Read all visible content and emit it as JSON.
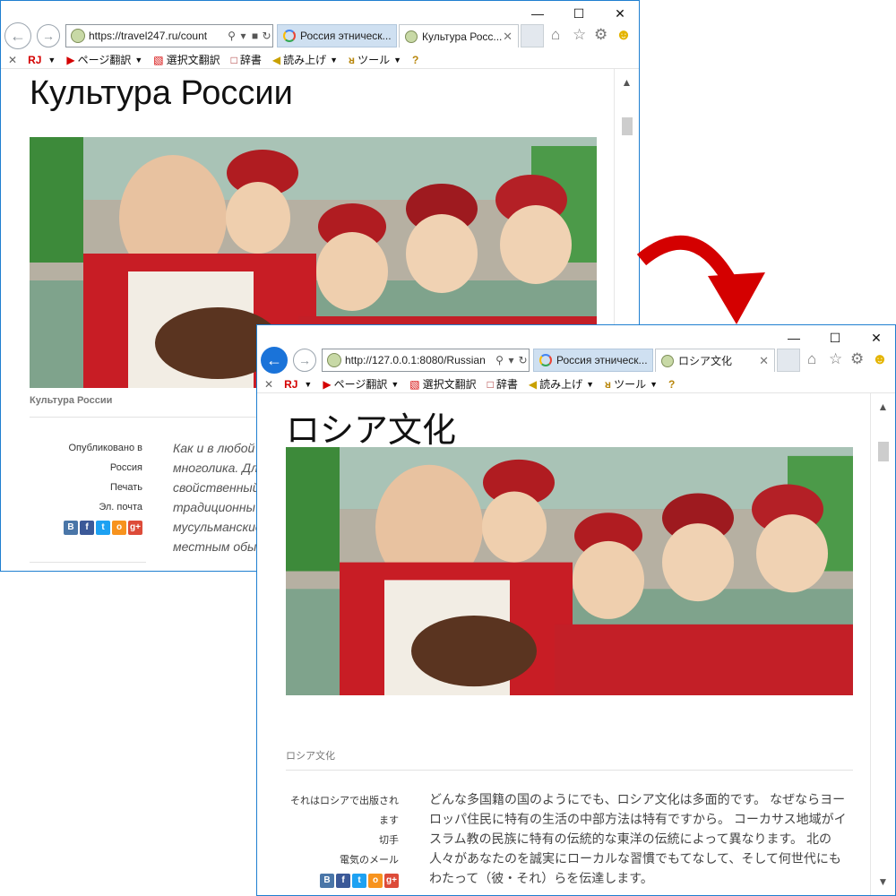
{
  "colors": {
    "accent": "#1a73d9",
    "window_border": "#1f7fd0",
    "arrow": "#d40000"
  },
  "window1": {
    "address_url": "https://travel247.ru/count",
    "tabs": [
      {
        "label": "Россия этническ...",
        "icon": "google-icon",
        "active": false
      },
      {
        "label": "Культура Росс...",
        "icon": "site-favicon",
        "active": true
      }
    ],
    "page_title": "Культура России",
    "caption": "Культура России",
    "meta": {
      "published_label": "Опубликовано в",
      "published_value": "Россия",
      "print": "Печать",
      "email": "Эл. почта"
    },
    "body_lines": [
      "Как и в любой",
      "многолика. Дл",
      "свойственный",
      "традиционны",
      "мусульманские",
      "местным обы"
    ]
  },
  "window2": {
    "address_url": "http://127.0.0.1:8080/Russian",
    "tabs": [
      {
        "label": "Россия этническ...",
        "icon": "google-icon",
        "active": false
      },
      {
        "label": "ロシア文化",
        "icon": "site-favicon",
        "active": true
      }
    ],
    "page_title": "ロシア文化",
    "caption": "ロシア文化",
    "meta": {
      "published_label": "それはロシアで出版され",
      "published_value": "ます",
      "print": "切手",
      "email": "電気のメール"
    },
    "body_lines": [
      "どんな多国籍の国のようにでも、ロシア文化は多面的です。 なぜならヨー",
      "ロッパ住民に特有の生活の中部方法は特有ですから。 コーカサス地域がイ",
      "スラム教の民族に特有の伝統的な東洋の伝統によって異なります。 北の",
      "人々があなたのを誠実にローカルな習慣でもてなして、そして何世代にも",
      "わたって（彼・それ）らを伝達します。"
    ]
  },
  "toolbar": {
    "rj_label": "RJ",
    "page_translate": "ページ翻訳",
    "selection_translate": "選択文翻訳",
    "dictionary": "辞書",
    "read_aloud": "読み上げ",
    "tools": "ツール"
  },
  "share_icons": [
    "В",
    "f",
    "t",
    "o",
    "g+"
  ],
  "share_names": [
    "vk-icon",
    "facebook-icon",
    "twitter-icon",
    "odnoklassniki-icon",
    "google-plus-icon"
  ]
}
